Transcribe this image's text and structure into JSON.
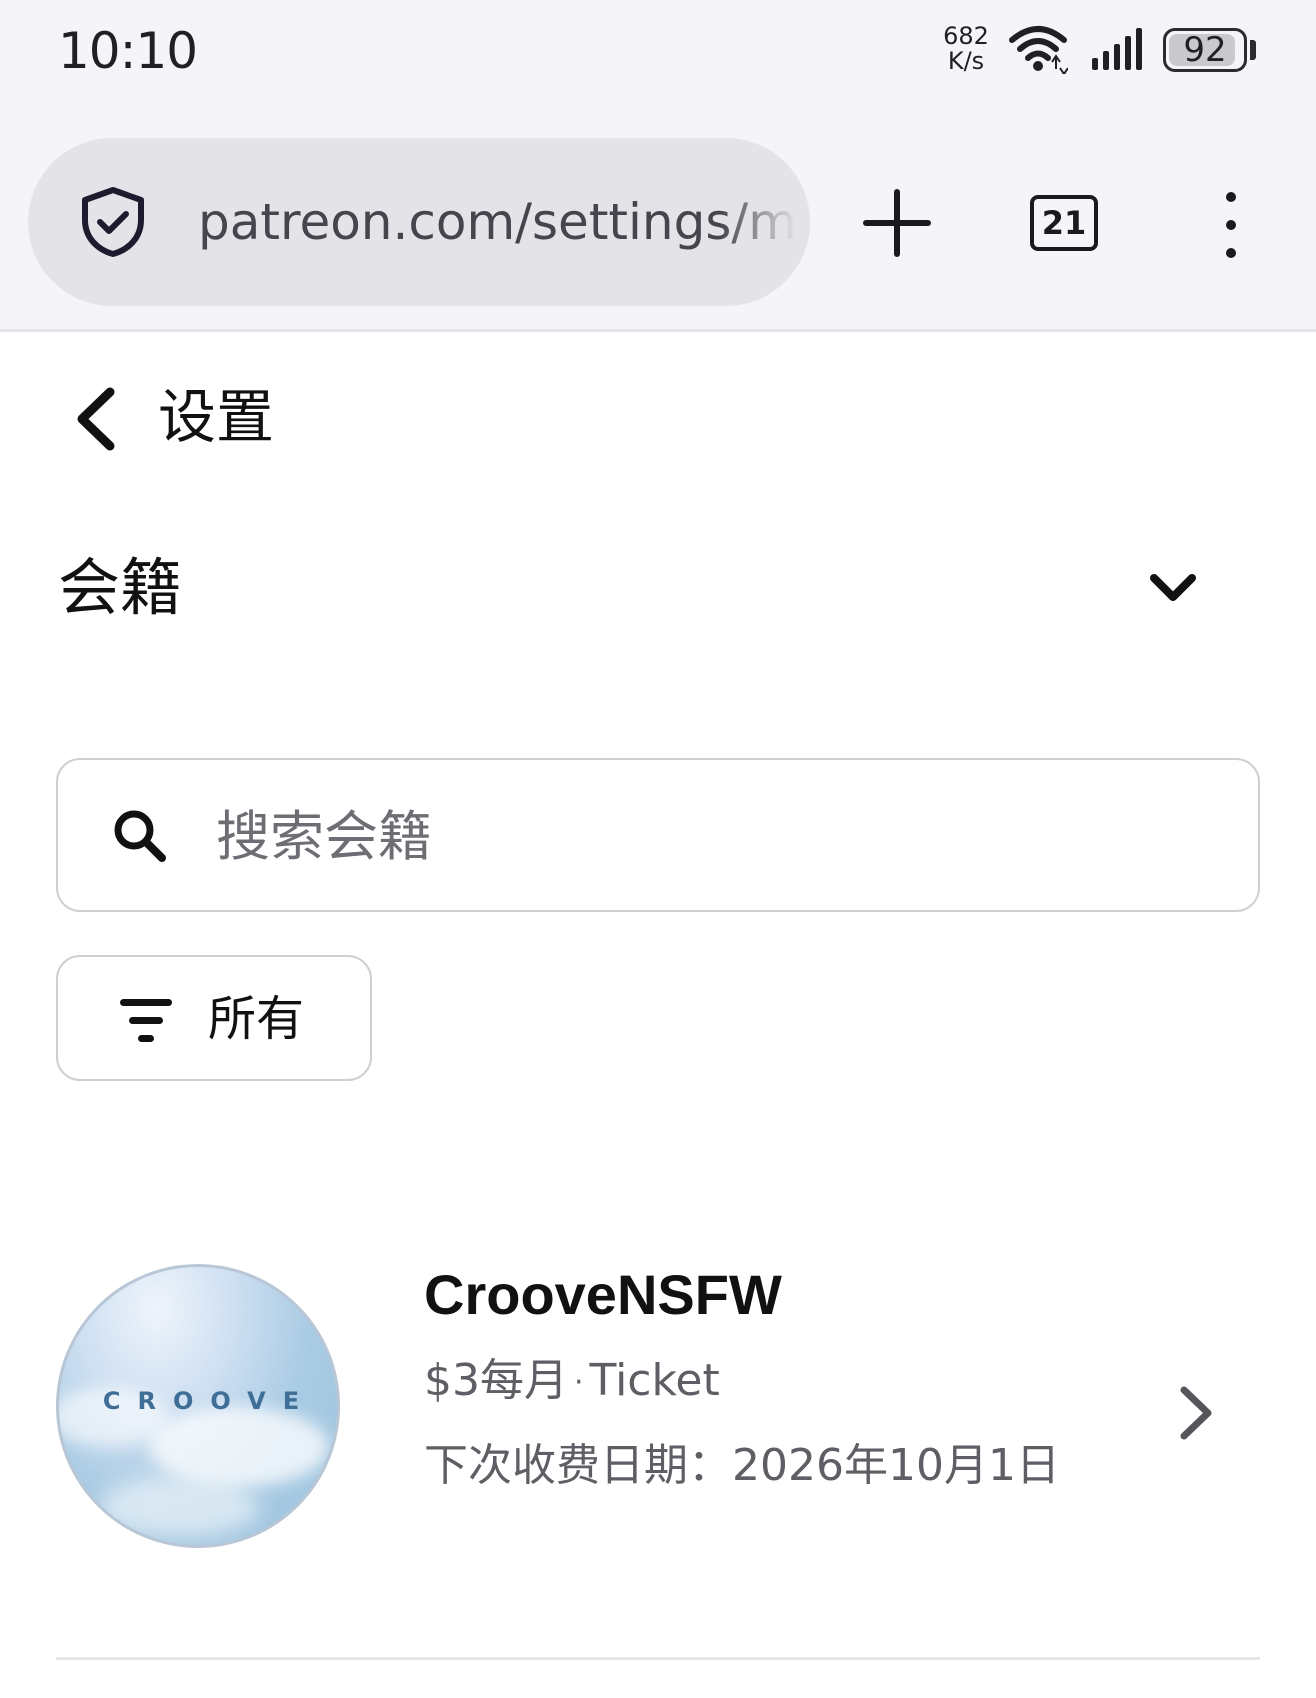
{
  "status_bar": {
    "time": "10:10",
    "net_speed_value": "682",
    "net_speed_unit": "K/s",
    "battery_level": "92",
    "battery_fraction": 0.92,
    "icons": [
      "wifi-icon",
      "signal-icon",
      "battery-icon"
    ]
  },
  "browser": {
    "url": "patreon.com/settings/m",
    "tab_count": "21",
    "icons": [
      "shield-check-icon",
      "plus-icon",
      "more-vert-icon"
    ]
  },
  "page": {
    "title": "设置",
    "section_title": "会籍",
    "search": {
      "placeholder": "搜索会籍",
      "value": ""
    },
    "filter_label": "所有",
    "icons": [
      "back-arrow-icon",
      "chevron-down-icon",
      "search-icon",
      "filter-icon",
      "chevron-right-icon"
    ]
  },
  "membership": {
    "creator_name": "CrooveNSFW",
    "avatar_text": "CROOVE",
    "price": "$3每月",
    "separator": "·",
    "tier": "Ticket",
    "next_charge": "下次收费日期：2026年10月1日"
  },
  "colors": {
    "chrome_background": "#f4f4f9",
    "url_pill": "#e3e3e8",
    "secondary_text": "#5e5e64",
    "border": "#cfcfd4"
  }
}
